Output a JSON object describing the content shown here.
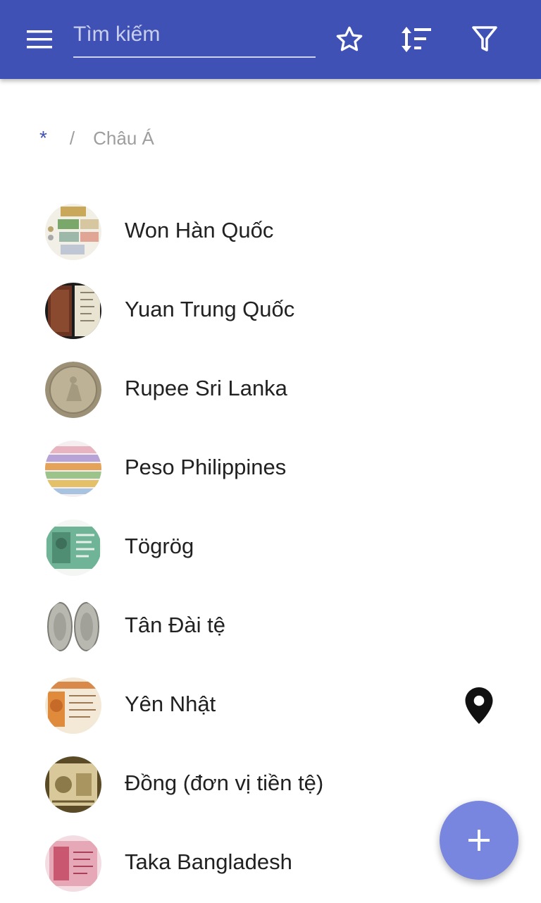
{
  "header": {
    "search_placeholder": "Tìm kiếm",
    "search_value": "",
    "background_color": "#3f51b5",
    "icons": [
      "menu-icon",
      "star-outline-icon",
      "sort-icon",
      "filter-icon"
    ]
  },
  "breadcrumb": {
    "root": "*",
    "separator": "/",
    "current": "Châu Á"
  },
  "currencies": [
    {
      "name": "Won Hàn Quốc",
      "icon": "currency-image",
      "pinned": false
    },
    {
      "name": "Yuan Trung Quốc",
      "icon": "currency-image",
      "pinned": false
    },
    {
      "name": "Rupee Sri Lanka",
      "icon": "coin-image",
      "pinned": false
    },
    {
      "name": "Peso Philippines",
      "icon": "currency-image",
      "pinned": false
    },
    {
      "name": "Tögrög",
      "icon": "currency-image",
      "pinned": false
    },
    {
      "name": "Tân Đài tệ",
      "icon": "coin-image",
      "pinned": false
    },
    {
      "name": "Yên Nhật",
      "icon": "currency-image",
      "pinned": true
    },
    {
      "name": "Đồng (đơn vị tiền tệ)",
      "icon": "currency-image",
      "pinned": false
    },
    {
      "name": "Taka Bangladesh",
      "icon": "currency-image",
      "pinned": false
    }
  ],
  "fab": {
    "icon": "plus-icon",
    "color": "#7986e0"
  }
}
